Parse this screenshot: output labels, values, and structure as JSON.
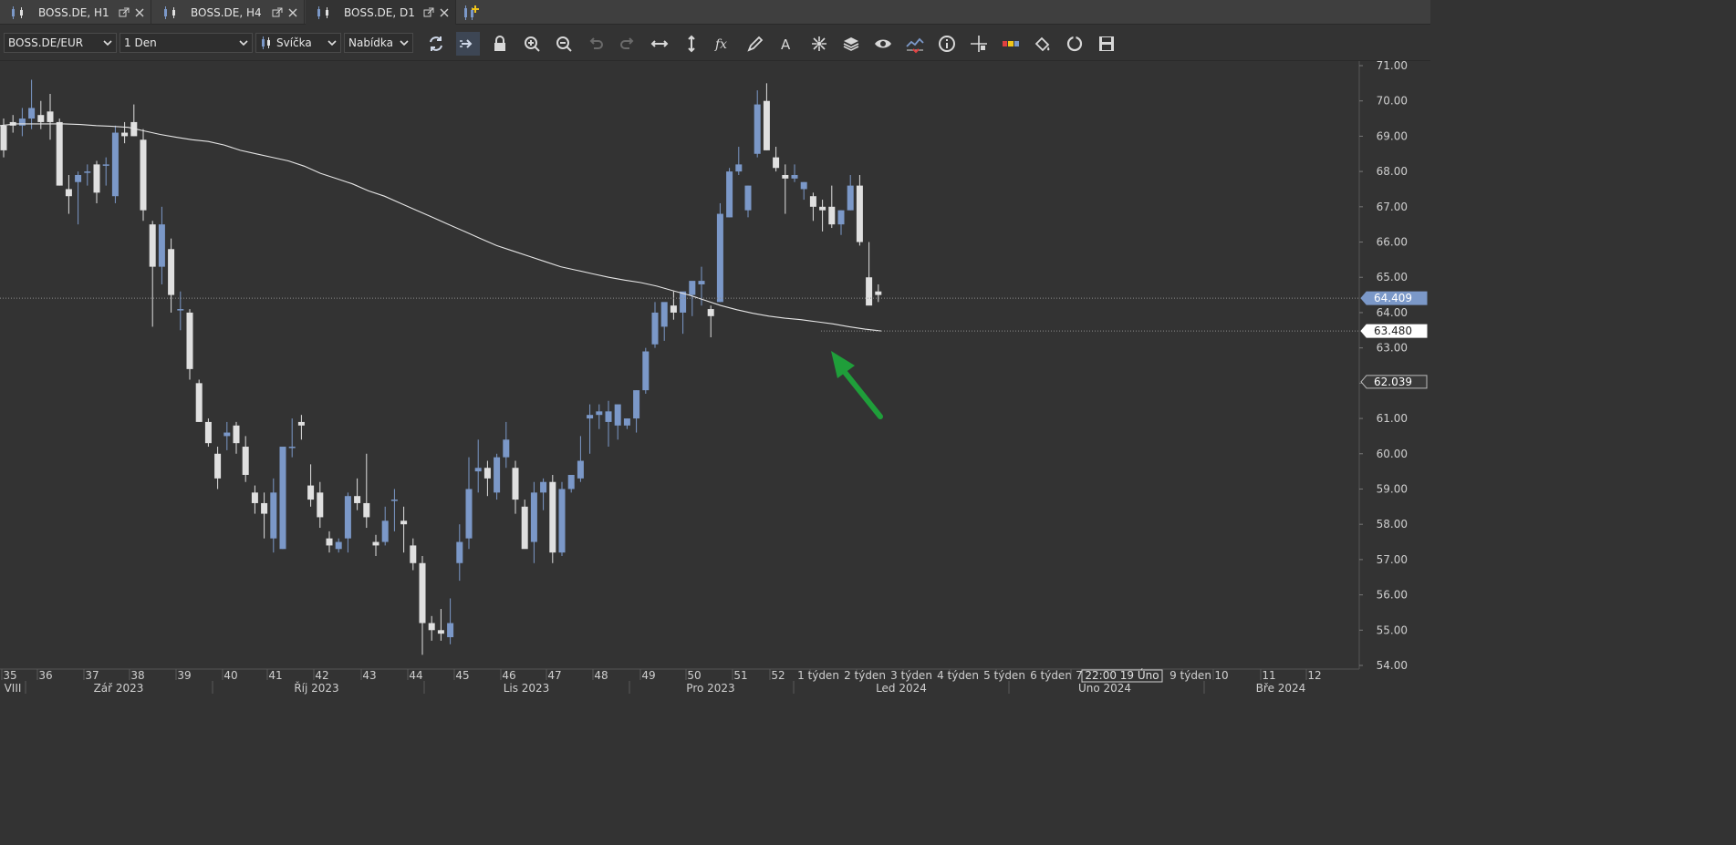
{
  "tabs": [
    {
      "title": "BOSS.DE, H1",
      "active": false
    },
    {
      "title": "BOSS.DE, H4",
      "active": false
    },
    {
      "title": "BOSS.DE, D1",
      "active": true
    }
  ],
  "toolbar": {
    "symbol": "BOSS.DE/EUR",
    "timeframe": "1 Den",
    "chart_type": "Svíčka",
    "price_type": "Nabídka",
    "icons": [
      "refresh-icon",
      "scroll-to-end-icon",
      "lock-icon",
      "zoom-in-icon",
      "zoom-out-icon",
      "undo-icon",
      "redo-icon",
      "horizontal-resize-icon",
      "vertical-resize-icon",
      "fx-indicator-icon",
      "pencil-icon",
      "text-tool-icon",
      "objects-icon",
      "layers-icon",
      "eye-icon",
      "compare-chart-icon",
      "info-icon",
      "crosshair-icon",
      "color-scale-icon",
      "paint-bucket-icon",
      "refresh-circle-icon",
      "save-icon"
    ]
  },
  "chart_data": {
    "type": "candlestick",
    "symbol": "BOSS.DE/EUR",
    "timeframe": "1 Den",
    "y_axis": {
      "range": [
        54.0,
        71.0
      ],
      "ticks": [
        "71.00",
        "70.00",
        "69.00",
        "68.00",
        "67.00",
        "66.00",
        "65.00",
        "64.00",
        "63.00",
        "62.00",
        "61.00",
        "60.00",
        "59.00",
        "58.00",
        "57.00",
        "56.00",
        "55.00",
        "54.00"
      ]
    },
    "price_labels": [
      {
        "text": "64.409",
        "value": 64.409,
        "color": "#7b98c8",
        "style": "bid"
      },
      {
        "text": "63.480",
        "value": 63.48,
        "color": "#ffffff",
        "style": "ma"
      },
      {
        "text": "62.039",
        "value": 62.039,
        "color": "#3a3a3a",
        "style": "outline"
      }
    ],
    "week_labels": [
      "35",
      "36",
      "37",
      "38",
      "39",
      "40",
      "41",
      "42",
      "43",
      "44",
      "45",
      "46",
      "47",
      "48",
      "49",
      "50",
      "51",
      "52",
      "1 týden",
      "2 týden",
      "3 týden",
      "4 týden",
      "5 týden",
      "6 týden",
      "7",
      "9 týden",
      "10",
      "11",
      "12"
    ],
    "month_labels": [
      "VIII",
      "Zář 2023",
      "Říj 2023",
      "Lis 2023",
      "Pro 2023",
      "Led 2024",
      "Úno 2024",
      "Bře 2024"
    ],
    "cursor_label": "22:00 19 Úno",
    "colors": {
      "bull": "#7b98c8",
      "bear": "#e0e0e0",
      "ma": "#e6e6e6",
      "arrow": "#1f9e3a"
    },
    "candles": [
      {
        "o": 69.3,
        "h": 69.5,
        "l": 68.4,
        "c": 68.6
      },
      {
        "o": 69.4,
        "h": 69.6,
        "l": 69.1,
        "c": 69.3
      },
      {
        "o": 69.3,
        "h": 69.8,
        "l": 69.0,
        "c": 69.5
      },
      {
        "o": 69.5,
        "h": 70.6,
        "l": 69.2,
        "c": 69.8
      },
      {
        "o": 69.6,
        "h": 70.0,
        "l": 69.2,
        "c": 69.4
      },
      {
        "o": 69.7,
        "h": 70.2,
        "l": 68.9,
        "c": 69.4
      },
      {
        "o": 69.4,
        "h": 69.5,
        "l": 67.6,
        "c": 67.6
      },
      {
        "o": 67.5,
        "h": 67.9,
        "l": 66.8,
        "c": 67.3
      },
      {
        "o": 67.7,
        "h": 68.0,
        "l": 66.5,
        "c": 67.9
      },
      {
        "o": 68.0,
        "h": 68.2,
        "l": 67.6,
        "c": 68.0
      },
      {
        "o": 68.2,
        "h": 68.3,
        "l": 67.1,
        "c": 67.4
      },
      {
        "o": 68.2,
        "h": 68.4,
        "l": 67.6,
        "c": 68.2
      },
      {
        "o": 67.3,
        "h": 69.3,
        "l": 67.1,
        "c": 69.1
      },
      {
        "o": 69.1,
        "h": 69.4,
        "l": 68.8,
        "c": 69.0
      },
      {
        "o": 69.4,
        "h": 69.9,
        "l": 69.0,
        "c": 69.0
      },
      {
        "o": 68.9,
        "h": 69.2,
        "l": 66.6,
        "c": 66.9
      },
      {
        "o": 66.5,
        "h": 66.6,
        "l": 63.6,
        "c": 65.3
      },
      {
        "o": 65.3,
        "h": 67.0,
        "l": 64.8,
        "c": 66.5
      },
      {
        "o": 65.8,
        "h": 66.1,
        "l": 64.0,
        "c": 64.5
      },
      {
        "o": 64.1,
        "h": 64.6,
        "l": 63.5,
        "c": 64.1
      },
      {
        "o": 64.0,
        "h": 64.1,
        "l": 62.1,
        "c": 62.4
      },
      {
        "o": 62.0,
        "h": 62.1,
        "l": 60.9,
        "c": 60.9
      },
      {
        "o": 60.9,
        "h": 61.0,
        "l": 60.2,
        "c": 60.3
      },
      {
        "o": 60.0,
        "h": 60.2,
        "l": 59.0,
        "c": 59.3
      },
      {
        "o": 60.5,
        "h": 60.9,
        "l": 60.1,
        "c": 60.6
      },
      {
        "o": 60.8,
        "h": 60.9,
        "l": 60.0,
        "c": 60.3
      },
      {
        "o": 60.2,
        "h": 60.5,
        "l": 59.2,
        "c": 59.4
      },
      {
        "o": 58.9,
        "h": 59.1,
        "l": 58.3,
        "c": 58.6
      },
      {
        "o": 58.6,
        "h": 58.9,
        "l": 57.6,
        "c": 58.3
      },
      {
        "o": 57.6,
        "h": 59.3,
        "l": 57.2,
        "c": 58.9
      },
      {
        "o": 57.3,
        "h": 60.2,
        "l": 57.3,
        "c": 60.2
      },
      {
        "o": 60.2,
        "h": 61.0,
        "l": 59.9,
        "c": 60.2
      },
      {
        "o": 60.9,
        "h": 61.1,
        "l": 60.4,
        "c": 60.8
      },
      {
        "o": 59.1,
        "h": 59.7,
        "l": 58.5,
        "c": 58.7
      },
      {
        "o": 58.9,
        "h": 59.2,
        "l": 57.9,
        "c": 58.2
      },
      {
        "o": 57.6,
        "h": 57.8,
        "l": 57.2,
        "c": 57.4
      },
      {
        "o": 57.3,
        "h": 57.6,
        "l": 57.2,
        "c": 57.5
      },
      {
        "o": 57.6,
        "h": 58.9,
        "l": 57.2,
        "c": 58.8
      },
      {
        "o": 58.8,
        "h": 59.3,
        "l": 58.4,
        "c": 58.6
      },
      {
        "o": 58.6,
        "h": 60.0,
        "l": 57.9,
        "c": 58.2
      },
      {
        "o": 57.5,
        "h": 57.7,
        "l": 57.1,
        "c": 57.4
      },
      {
        "o": 57.5,
        "h": 58.5,
        "l": 57.4,
        "c": 58.1
      },
      {
        "o": 58.7,
        "h": 59.0,
        "l": 57.8,
        "c": 58.7
      },
      {
        "o": 58.1,
        "h": 58.5,
        "l": 57.2,
        "c": 58.0
      },
      {
        "o": 57.4,
        "h": 57.6,
        "l": 56.7,
        "c": 56.9
      },
      {
        "o": 56.9,
        "h": 57.1,
        "l": 54.3,
        "c": 55.2
      },
      {
        "o": 55.2,
        "h": 55.4,
        "l": 54.7,
        "c": 55.0
      },
      {
        "o": 55.0,
        "h": 55.6,
        "l": 54.7,
        "c": 54.9
      },
      {
        "o": 54.8,
        "h": 55.9,
        "l": 54.6,
        "c": 55.2
      },
      {
        "o": 56.9,
        "h": 58.0,
        "l": 56.4,
        "c": 57.5
      },
      {
        "o": 57.6,
        "h": 59.9,
        "l": 57.3,
        "c": 59.0
      },
      {
        "o": 59.5,
        "h": 60.4,
        "l": 58.9,
        "c": 59.6
      },
      {
        "o": 59.6,
        "h": 59.8,
        "l": 58.8,
        "c": 59.3
      },
      {
        "o": 58.9,
        "h": 60.0,
        "l": 58.7,
        "c": 59.9
      },
      {
        "o": 59.9,
        "h": 60.9,
        "l": 59.6,
        "c": 60.4
      },
      {
        "o": 59.6,
        "h": 59.8,
        "l": 58.3,
        "c": 58.7
      },
      {
        "o": 58.5,
        "h": 58.7,
        "l": 57.5,
        "c": 57.3
      },
      {
        "o": 57.5,
        "h": 59.2,
        "l": 56.9,
        "c": 58.9
      },
      {
        "o": 58.9,
        "h": 59.3,
        "l": 58.4,
        "c": 59.2
      },
      {
        "o": 59.2,
        "h": 59.4,
        "l": 56.9,
        "c": 57.2
      },
      {
        "o": 57.2,
        "h": 59.2,
        "l": 57.1,
        "c": 59.0
      },
      {
        "o": 59.0,
        "h": 59.4,
        "l": 58.9,
        "c": 59.4
      },
      {
        "o": 59.3,
        "h": 60.5,
        "l": 59.2,
        "c": 59.8
      },
      {
        "o": 61.0,
        "h": 61.4,
        "l": 60.0,
        "c": 61.1
      },
      {
        "o": 61.1,
        "h": 61.4,
        "l": 60.7,
        "c": 61.2
      },
      {
        "o": 60.9,
        "h": 61.5,
        "l": 60.2,
        "c": 61.2
      },
      {
        "o": 60.8,
        "h": 61.0,
        "l": 60.4,
        "c": 61.4
      },
      {
        "o": 60.8,
        "h": 61.0,
        "l": 60.7,
        "c": 61.0
      },
      {
        "o": 61.0,
        "h": 61.8,
        "l": 60.6,
        "c": 61.8
      },
      {
        "o": 61.8,
        "h": 63.0,
        "l": 61.7,
        "c": 62.9
      },
      {
        "o": 63.1,
        "h": 64.3,
        "l": 63.0,
        "c": 64.0
      },
      {
        "o": 63.6,
        "h": 64.1,
        "l": 63.2,
        "c": 64.3
      },
      {
        "o": 64.2,
        "h": 64.6,
        "l": 63.8,
        "c": 64.0
      },
      {
        "o": 64.0,
        "h": 64.4,
        "l": 63.4,
        "c": 64.6
      },
      {
        "o": 64.5,
        "h": 64.8,
        "l": 63.9,
        "c": 64.9
      },
      {
        "o": 64.8,
        "h": 65.3,
        "l": 64.2,
        "c": 64.9
      },
      {
        "o": 64.1,
        "h": 64.2,
        "l": 63.3,
        "c": 63.9
      },
      {
        "o": 64.3,
        "h": 67.1,
        "l": 64.3,
        "c": 66.8
      },
      {
        "o": 66.7,
        "h": 68.1,
        "l": 66.7,
        "c": 68.0
      },
      {
        "o": 68.0,
        "h": 68.7,
        "l": 67.9,
        "c": 68.2
      },
      {
        "o": 66.9,
        "h": 67.6,
        "l": 66.7,
        "c": 67.6
      },
      {
        "o": 68.5,
        "h": 70.3,
        "l": 68.4,
        "c": 69.9
      },
      {
        "o": 70.0,
        "h": 70.5,
        "l": 68.6,
        "c": 68.6
      },
      {
        "o": 68.4,
        "h": 68.7,
        "l": 68.0,
        "c": 68.1
      },
      {
        "o": 67.9,
        "h": 68.2,
        "l": 66.8,
        "c": 67.8
      },
      {
        "o": 67.8,
        "h": 68.2,
        "l": 67.7,
        "c": 67.9
      },
      {
        "o": 67.5,
        "h": 67.7,
        "l": 67.2,
        "c": 67.7
      },
      {
        "o": 67.3,
        "h": 67.4,
        "l": 66.6,
        "c": 67.0
      },
      {
        "o": 67.0,
        "h": 67.2,
        "l": 66.3,
        "c": 66.9
      },
      {
        "o": 67.0,
        "h": 67.6,
        "l": 66.4,
        "c": 66.5
      },
      {
        "o": 66.5,
        "h": 66.9,
        "l": 66.2,
        "c": 66.9
      },
      {
        "o": 66.9,
        "h": 67.9,
        "l": 66.9,
        "c": 67.6
      },
      {
        "o": 67.6,
        "h": 67.9,
        "l": 65.9,
        "c": 66.0
      },
      {
        "o": 65.0,
        "h": 66.0,
        "l": 64.4,
        "c": 64.2
      },
      {
        "o": 64.6,
        "h": 64.8,
        "l": 64.3,
        "c": 64.5
      }
    ],
    "moving_average": [
      69.3,
      69.35,
      69.35,
      69.35,
      69.35,
      69.33,
      69.3,
      69.28,
      69.25,
      69.15,
      69.05,
      68.97,
      68.9,
      68.85,
      68.75,
      68.6,
      68.5,
      68.4,
      68.3,
      68.15,
      67.95,
      67.8,
      67.65,
      67.45,
      67.3,
      67.1,
      66.9,
      66.7,
      66.5,
      66.3,
      66.1,
      65.9,
      65.75,
      65.6,
      65.45,
      65.3,
      65.2,
      65.1,
      65.0,
      64.92,
      64.85,
      64.75,
      64.62,
      64.5,
      64.35,
      64.2,
      64.08,
      63.98,
      63.9,
      63.84,
      63.8,
      63.74,
      63.68,
      63.6,
      63.53,
      63.48
    ]
  }
}
